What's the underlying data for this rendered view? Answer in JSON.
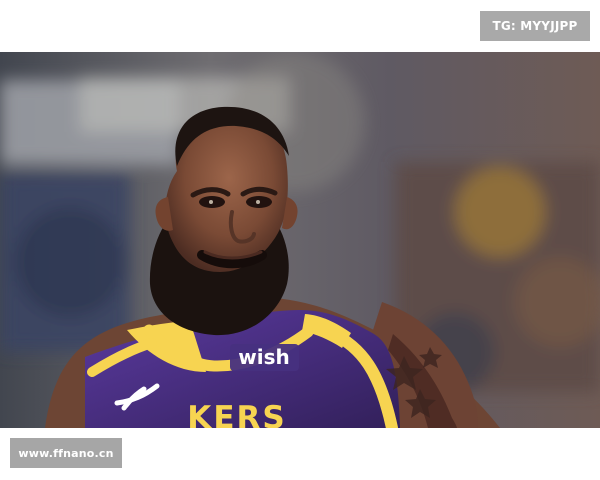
{
  "watermarks": {
    "top": "TG: MYYJJPP",
    "bottom": "www.ffnano.cn"
  },
  "photo": {
    "alt": "Basketball player in purple jersey smiling",
    "jersey_brand": "wish",
    "jersey_partial_text": "KERS",
    "colors": {
      "jersey": "#4b2e83",
      "trim": "#f7d451",
      "skin": "#7a4a35",
      "beard": "#1b120f"
    }
  }
}
